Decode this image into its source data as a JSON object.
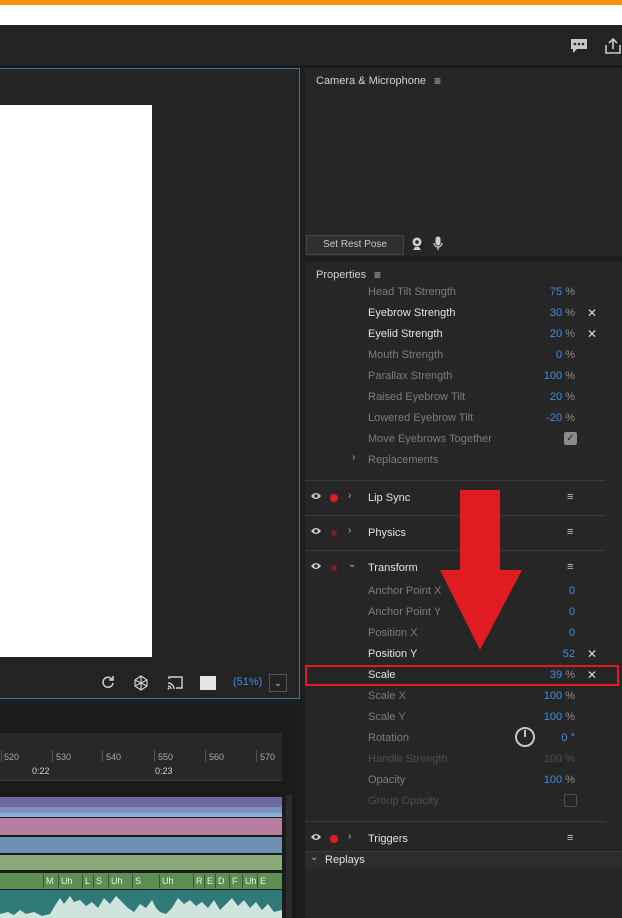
{
  "camera_panel": {
    "title": "Camera & Microphone",
    "rest_pose_button": "Set Rest Pose"
  },
  "properties_panel": {
    "title": "Properties",
    "rows": [
      {
        "label": "Head Tilt Strength",
        "value": "75",
        "unit": "%"
      },
      {
        "label": "Eyebrow Strength",
        "value": "30",
        "unit": "%"
      },
      {
        "label": "Eyelid Strength",
        "value": "20",
        "unit": "%"
      },
      {
        "label": "Mouth Strength",
        "value": "0",
        "unit": "%"
      },
      {
        "label": "Parallax Strength",
        "value": "100",
        "unit": "%"
      },
      {
        "label": "Raised Eyebrow Tilt",
        "value": "20",
        "unit": "%"
      },
      {
        "label": "Lowered Eyebrow Tilt",
        "value": "-20",
        "unit": "%"
      },
      {
        "label": "Move Eyebrows Together"
      },
      {
        "label": "Replacements"
      }
    ],
    "sections": {
      "lip_sync": "Lip Sync",
      "physics": "Physics",
      "transform": "Transform",
      "triggers": "Triggers",
      "replays": "Replays"
    },
    "transform_rows": [
      {
        "label": "Anchor Point X",
        "value": "0"
      },
      {
        "label": "Anchor Point Y",
        "value": "0"
      },
      {
        "label": "Position X",
        "value": "0"
      },
      {
        "label": "Position Y",
        "value": "52"
      },
      {
        "label": "Scale",
        "value": "39",
        "unit": "%"
      },
      {
        "label": "Scale X",
        "value": "100",
        "unit": "%"
      },
      {
        "label": "Scale Y",
        "value": "100",
        "unit": "%"
      },
      {
        "label": "Rotation",
        "value": "0",
        "unit": "°"
      },
      {
        "label": "Handle Strength",
        "value": "100",
        "unit": "%"
      },
      {
        "label": "Opacity",
        "value": "100",
        "unit": "%"
      },
      {
        "label": "Group Opacity"
      }
    ]
  },
  "scene": {
    "zoom": "(51%)",
    "zoom_dropdown_glyph": "⌄"
  },
  "timeline": {
    "ruler_numbers": [
      "520",
      "530",
      "540",
      "550",
      "560",
      "570"
    ],
    "ruler_times": [
      "0:22",
      "0:23"
    ],
    "visemes": [
      "M",
      "Uh",
      "L",
      "S",
      "Uh",
      "S",
      "Uh",
      "R",
      "E",
      "D",
      "F",
      "Uh",
      "E"
    ]
  },
  "glyphs": {
    "chevron_right": "›",
    "chevron_down": "⌄",
    "hamburger": "≡",
    "close": "✕",
    "eye": "👁",
    "check": "✓"
  },
  "colors": {
    "accent_blue": "#3d8ee6",
    "record_red": "#e11b22",
    "highlight_red": "#e11b22",
    "orange": "#f29111"
  }
}
